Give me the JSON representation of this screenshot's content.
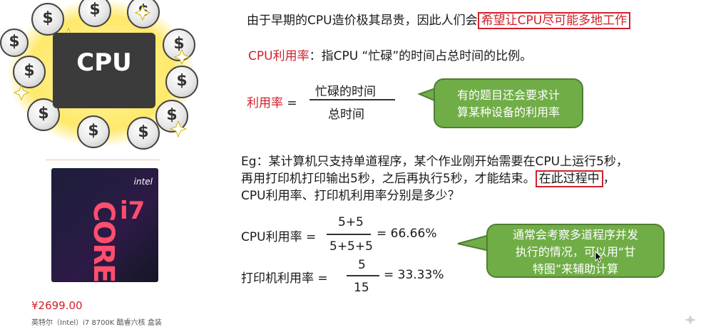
{
  "intro": {
    "prefix": "由于早期的CPU造价极其昂贵，因此人们会",
    "highlight": "希望让CPU尽可能多地工作"
  },
  "definition": {
    "term": "CPU利用率",
    "colon": "：",
    "text": "指CPU “忙碌”的时间占总时间的比例。"
  },
  "formula": {
    "label": "利用率",
    "eq": "=",
    "numerator": "忙碌的时间",
    "denominator": "总时间"
  },
  "callout1": {
    "line1": "有的题目还会要求计",
    "line2": "算某种设备的利用率"
  },
  "example": {
    "line1": "Eg：某计算机只支持单道程序，某个作业刚开始需要在CPU上运行5秒，",
    "line2_prefix": "再用打印机打印输出5秒，之后再执行5秒，才能结束。",
    "line2_highlight": "在此过程中",
    "line2_suffix": "，",
    "line3": "CPU利用率、打印机利用率分别是多少？"
  },
  "calc_cpu": {
    "label": "CPU利用率 =",
    "numerator": "5+5",
    "denominator": "5+5+5",
    "result": "= 66.66%"
  },
  "calc_printer": {
    "label": "打印机利用率 =",
    "numerator": "5",
    "denominator": "15",
    "result": "= 33.33%"
  },
  "callout2": {
    "line1": "通常会考察多道程序并发",
    "line2": "执行的情况，可以用“甘",
    "line3": "特图”来辅助计算"
  },
  "illustration": {
    "chip_label": "CPU",
    "coin_symbol": "$"
  },
  "product": {
    "price": "¥2699.00",
    "name": "英特尔（Intel）i7 8700K 酷睿六核 盒装",
    "box_brand": "intel",
    "box_word": "CORE",
    "box_model": "i7"
  },
  "colors": {
    "accent_red": "#d0202a",
    "callout_green": "#70ad47"
  },
  "icons": [
    "dollar-coin-icon",
    "sparkle-icon",
    "cpu-chip-icon",
    "mouse-cursor-icon",
    "sparkle-corner-icon"
  ]
}
